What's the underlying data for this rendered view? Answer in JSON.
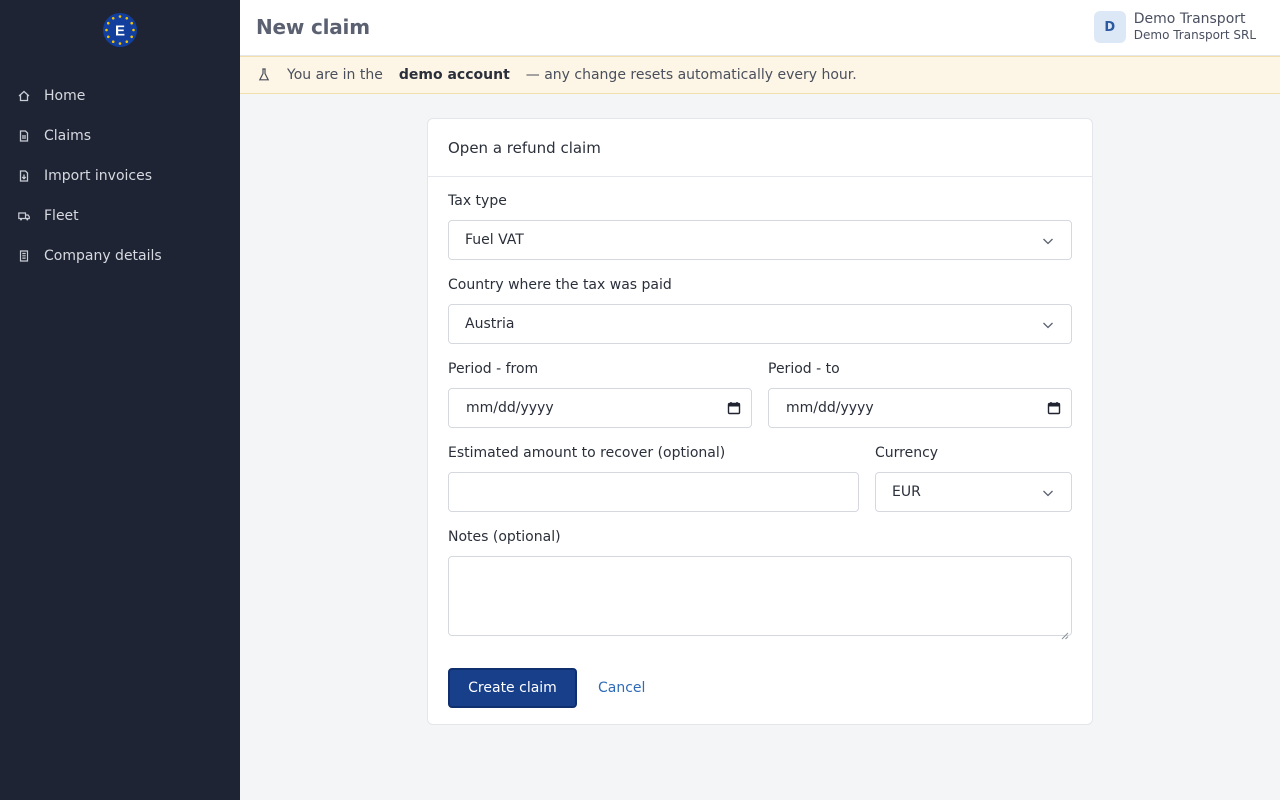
{
  "header": {
    "title": "New claim",
    "avatar_initial": "D",
    "account_name": "Demo Transport",
    "account_company": "Demo Transport SRL"
  },
  "banner": {
    "prefix": "You are in the",
    "highlight": "demo account",
    "suffix": "— any change resets automatically every hour."
  },
  "sidebar": {
    "logo_letter": "E",
    "items": [
      {
        "label": "Home",
        "icon": "home-icon"
      },
      {
        "label": "Claims",
        "icon": "document-icon"
      },
      {
        "label": "Import invoices",
        "icon": "file-import-icon"
      },
      {
        "label": "Fleet",
        "icon": "truck-icon"
      },
      {
        "label": "Company details",
        "icon": "building-icon"
      }
    ]
  },
  "form": {
    "title": "Open a refund claim",
    "tax_type": {
      "label": "Tax type",
      "value": "Fuel VAT"
    },
    "country": {
      "label": "Country where the tax was paid",
      "value": "Austria"
    },
    "period_from": {
      "label": "Period - from",
      "placeholder": "mm/dd/yyyy"
    },
    "period_to": {
      "label": "Period - to",
      "placeholder": "mm/dd/yyyy"
    },
    "amount": {
      "label": "Estimated amount to recover (optional)",
      "value": ""
    },
    "currency": {
      "label": "Currency",
      "value": "EUR"
    },
    "notes": {
      "label": "Notes (optional)",
      "value": ""
    },
    "submit_label": "Create claim",
    "cancel_label": "Cancel"
  },
  "colors": {
    "sidebar_bg": "#1e2433",
    "primary": "#173f8a",
    "link": "#2f6bb8",
    "banner_bg": "#fdf6e6"
  }
}
